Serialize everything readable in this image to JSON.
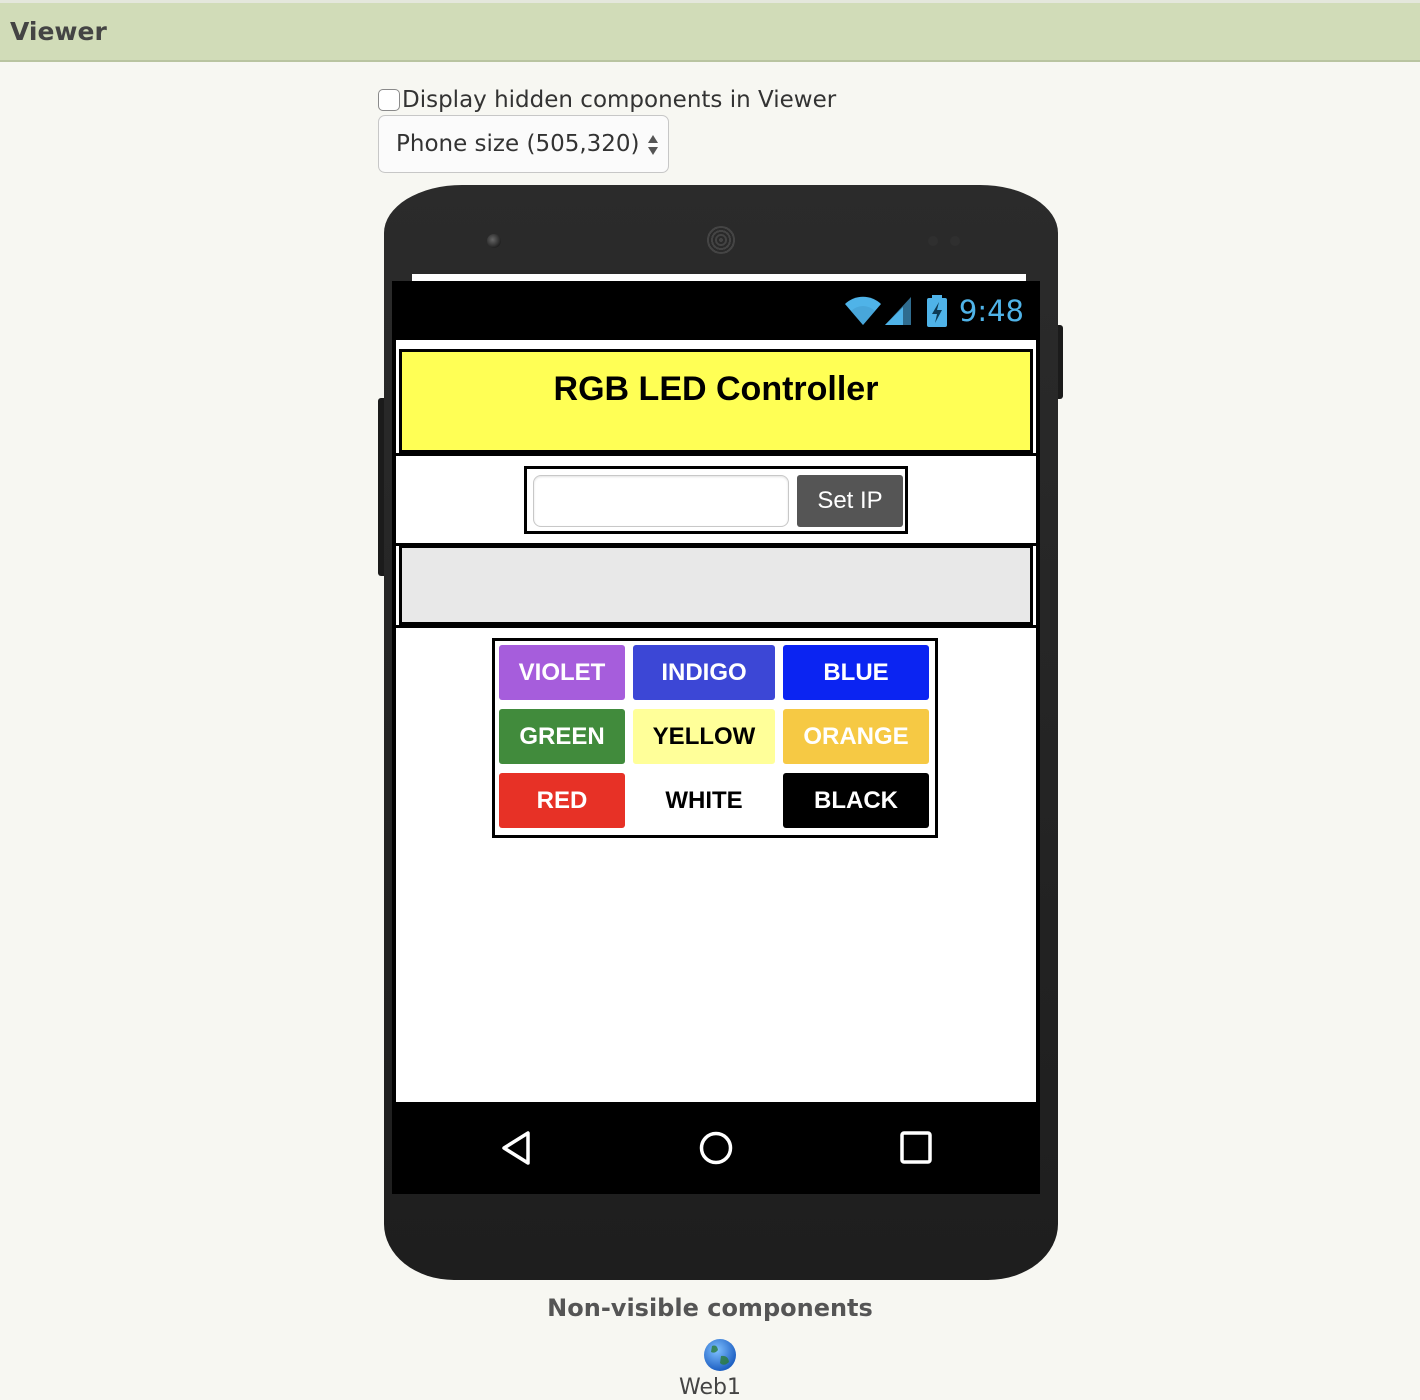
{
  "viewer": {
    "title": "Viewer",
    "hidden_components_label": "Display hidden components in Viewer",
    "hidden_components_checked": false,
    "phone_size_selected": "Phone size (505,320)"
  },
  "phone": {
    "status_time": "9:48",
    "app": {
      "title": "RGB LED Controller",
      "ip_input_value": "",
      "set_ip_label": "Set IP",
      "color_buttons": [
        {
          "label": "VIOLET",
          "bg": "#a65ddc",
          "fg": "#ffffff"
        },
        {
          "label": "INDIGO",
          "bg": "#3c47d6",
          "fg": "#ffffff"
        },
        {
          "label": "BLUE",
          "bg": "#0b24f2",
          "fg": "#ffffff"
        },
        {
          "label": "GREEN",
          "bg": "#418b3c",
          "fg": "#ffffff"
        },
        {
          "label": "YELLOW",
          "bg": "#ffff99",
          "fg": "#000000"
        },
        {
          "label": "ORANGE",
          "bg": "#f6c944",
          "fg": "#ffffff"
        },
        {
          "label": "RED",
          "bg": "#e73126",
          "fg": "#ffffff"
        },
        {
          "label": "WHITE",
          "bg": "#ffffff",
          "fg": "#000000"
        },
        {
          "label": "BLACK",
          "bg": "#000000",
          "fg": "#ffffff"
        }
      ]
    },
    "nav": {
      "back_icon": "back-triangle-icon",
      "home_icon": "home-circle-icon",
      "recents_icon": "recents-square-icon"
    }
  },
  "non_visible": {
    "title": "Non-visible components",
    "items": [
      {
        "label": "Web1",
        "icon": "globe-icon"
      }
    ]
  },
  "colors": {
    "header_bg": "#d1dcb8",
    "title_bg": "#ffff55",
    "status_accent": "#4fb3e8"
  }
}
